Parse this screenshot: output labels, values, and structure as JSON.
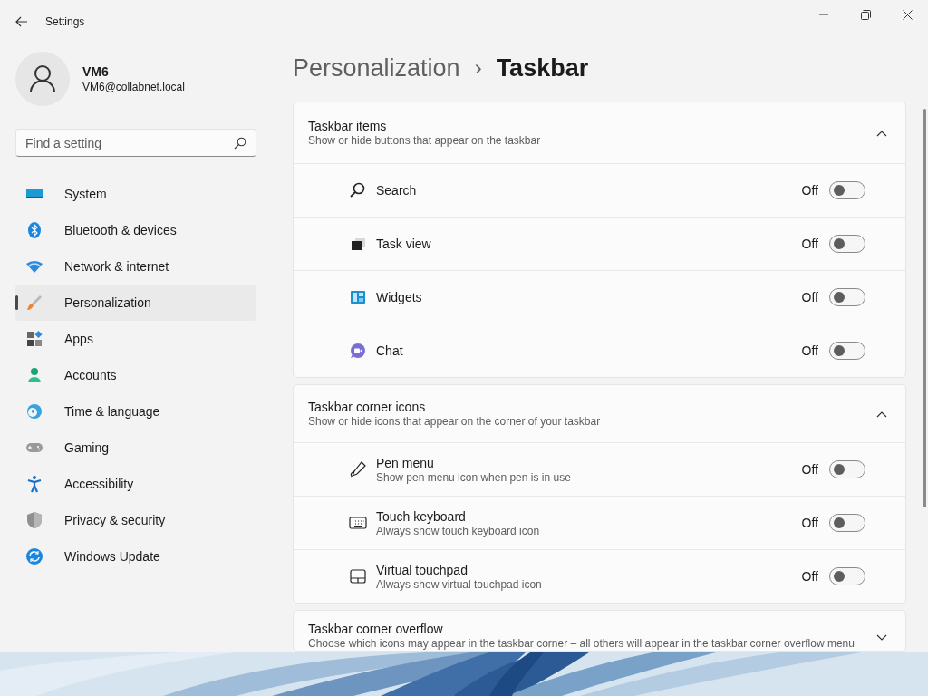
{
  "window": {
    "title": "Settings"
  },
  "user": {
    "name": "VM6",
    "email": "VM6@collabnet.local"
  },
  "search": {
    "placeholder": "Find a setting"
  },
  "sidebar": {
    "items": [
      {
        "label": "System",
        "selected": false
      },
      {
        "label": "Bluetooth & devices",
        "selected": false
      },
      {
        "label": "Network & internet",
        "selected": false
      },
      {
        "label": "Personalization",
        "selected": true
      },
      {
        "label": "Apps",
        "selected": false
      },
      {
        "label": "Accounts",
        "selected": false
      },
      {
        "label": "Time & language",
        "selected": false
      },
      {
        "label": "Gaming",
        "selected": false
      },
      {
        "label": "Accessibility",
        "selected": false
      },
      {
        "label": "Privacy & security",
        "selected": false
      },
      {
        "label": "Windows Update",
        "selected": false
      }
    ]
  },
  "breadcrumb": {
    "parent": "Personalization",
    "separator": "›",
    "current": "Taskbar"
  },
  "sections": [
    {
      "title": "Taskbar items",
      "description": "Show or hide buttons that appear on the taskbar",
      "expanded": true,
      "items": [
        {
          "label": "Search",
          "state_text": "Off",
          "on": false
        },
        {
          "label": "Task view",
          "state_text": "Off",
          "on": false
        },
        {
          "label": "Widgets",
          "state_text": "Off",
          "on": false
        },
        {
          "label": "Chat",
          "state_text": "Off",
          "on": false
        }
      ]
    },
    {
      "title": "Taskbar corner icons",
      "description": "Show or hide icons that appear on the corner of your taskbar",
      "expanded": true,
      "items": [
        {
          "label": "Pen menu",
          "description": "Show pen menu icon when pen is in use",
          "state_text": "Off",
          "on": false
        },
        {
          "label": "Touch keyboard",
          "description": "Always show touch keyboard icon",
          "state_text": "Off",
          "on": false
        },
        {
          "label": "Virtual touchpad",
          "description": "Always show virtual touchpad icon",
          "state_text": "Off",
          "on": false
        }
      ]
    },
    {
      "title": "Taskbar corner overflow",
      "description": "Choose which icons may appear in the taskbar corner – all others will appear in the taskbar corner overflow menu",
      "expanded": false
    }
  ]
}
